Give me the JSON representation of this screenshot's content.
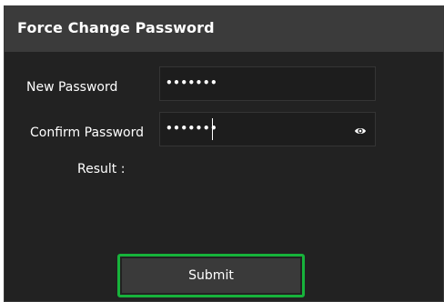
{
  "dialog": {
    "title": "Force Change Password"
  },
  "form": {
    "new_password": {
      "label": "New Password",
      "value": "•••••••"
    },
    "confirm_password": {
      "label": "Confirm Password",
      "value": "•••••••"
    },
    "result_label": "Result :",
    "submit_label": "Submit"
  },
  "icons": {
    "show_password": "eye-icon"
  },
  "colors": {
    "accent": "#17b33b",
    "panel_bg": "#222222",
    "header_bg": "#3b3b3b"
  }
}
